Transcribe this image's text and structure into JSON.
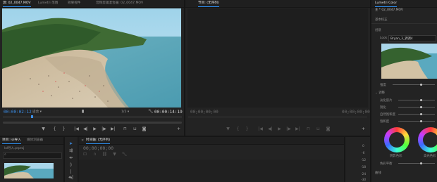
{
  "source_monitor": {
    "tabs": [
      "源: 02_0047.MOV",
      "Lumetri 范围",
      "效果控件",
      "音频剪辑混合器: 02_0047.MOV"
    ],
    "timecode_current": "00:00:02:12",
    "fit_select": "适合",
    "page_ratio": "1/2",
    "timecode_duration": "00:00:14:19"
  },
  "program_monitor": {
    "tabs": [
      "节目: (无序列)"
    ],
    "timecode_left": "00;00;00;00",
    "timecode_right": "00;00;00;00"
  },
  "lumetri": {
    "tab_title": "Lumetri Color",
    "clip_name": "主 * 02_0047.MOV",
    "basic_correction": "基本校正",
    "creative": "创意",
    "look_label": "Look",
    "look_value": "Bryan_3_调调4",
    "intensity_label": "强度",
    "adjustments": "调整",
    "adjust_items": [
      "淡化胶片",
      "锐化",
      "自然饱和度",
      "饱和度"
    ],
    "shadow_tint": "阴影色彩",
    "highlight_tint": "高光色彩",
    "tint_balance": "色彩平衡",
    "curves": "曲线"
  },
  "project": {
    "tabs": [
      "项目: lol导入",
      "媒体浏览器"
    ],
    "project_file": "lol导入.prproj"
  },
  "timeline": {
    "tab": "时间轴: (无序列)",
    "timecode": "00;00;00;00"
  },
  "audio_meter": {
    "labels": [
      "0",
      "-6",
      "-12",
      "-18",
      "-24",
      "-30"
    ]
  },
  "colors": {
    "accent": "#3c8ee8",
    "panel": "#232323",
    "background": "#1b1b1b"
  }
}
